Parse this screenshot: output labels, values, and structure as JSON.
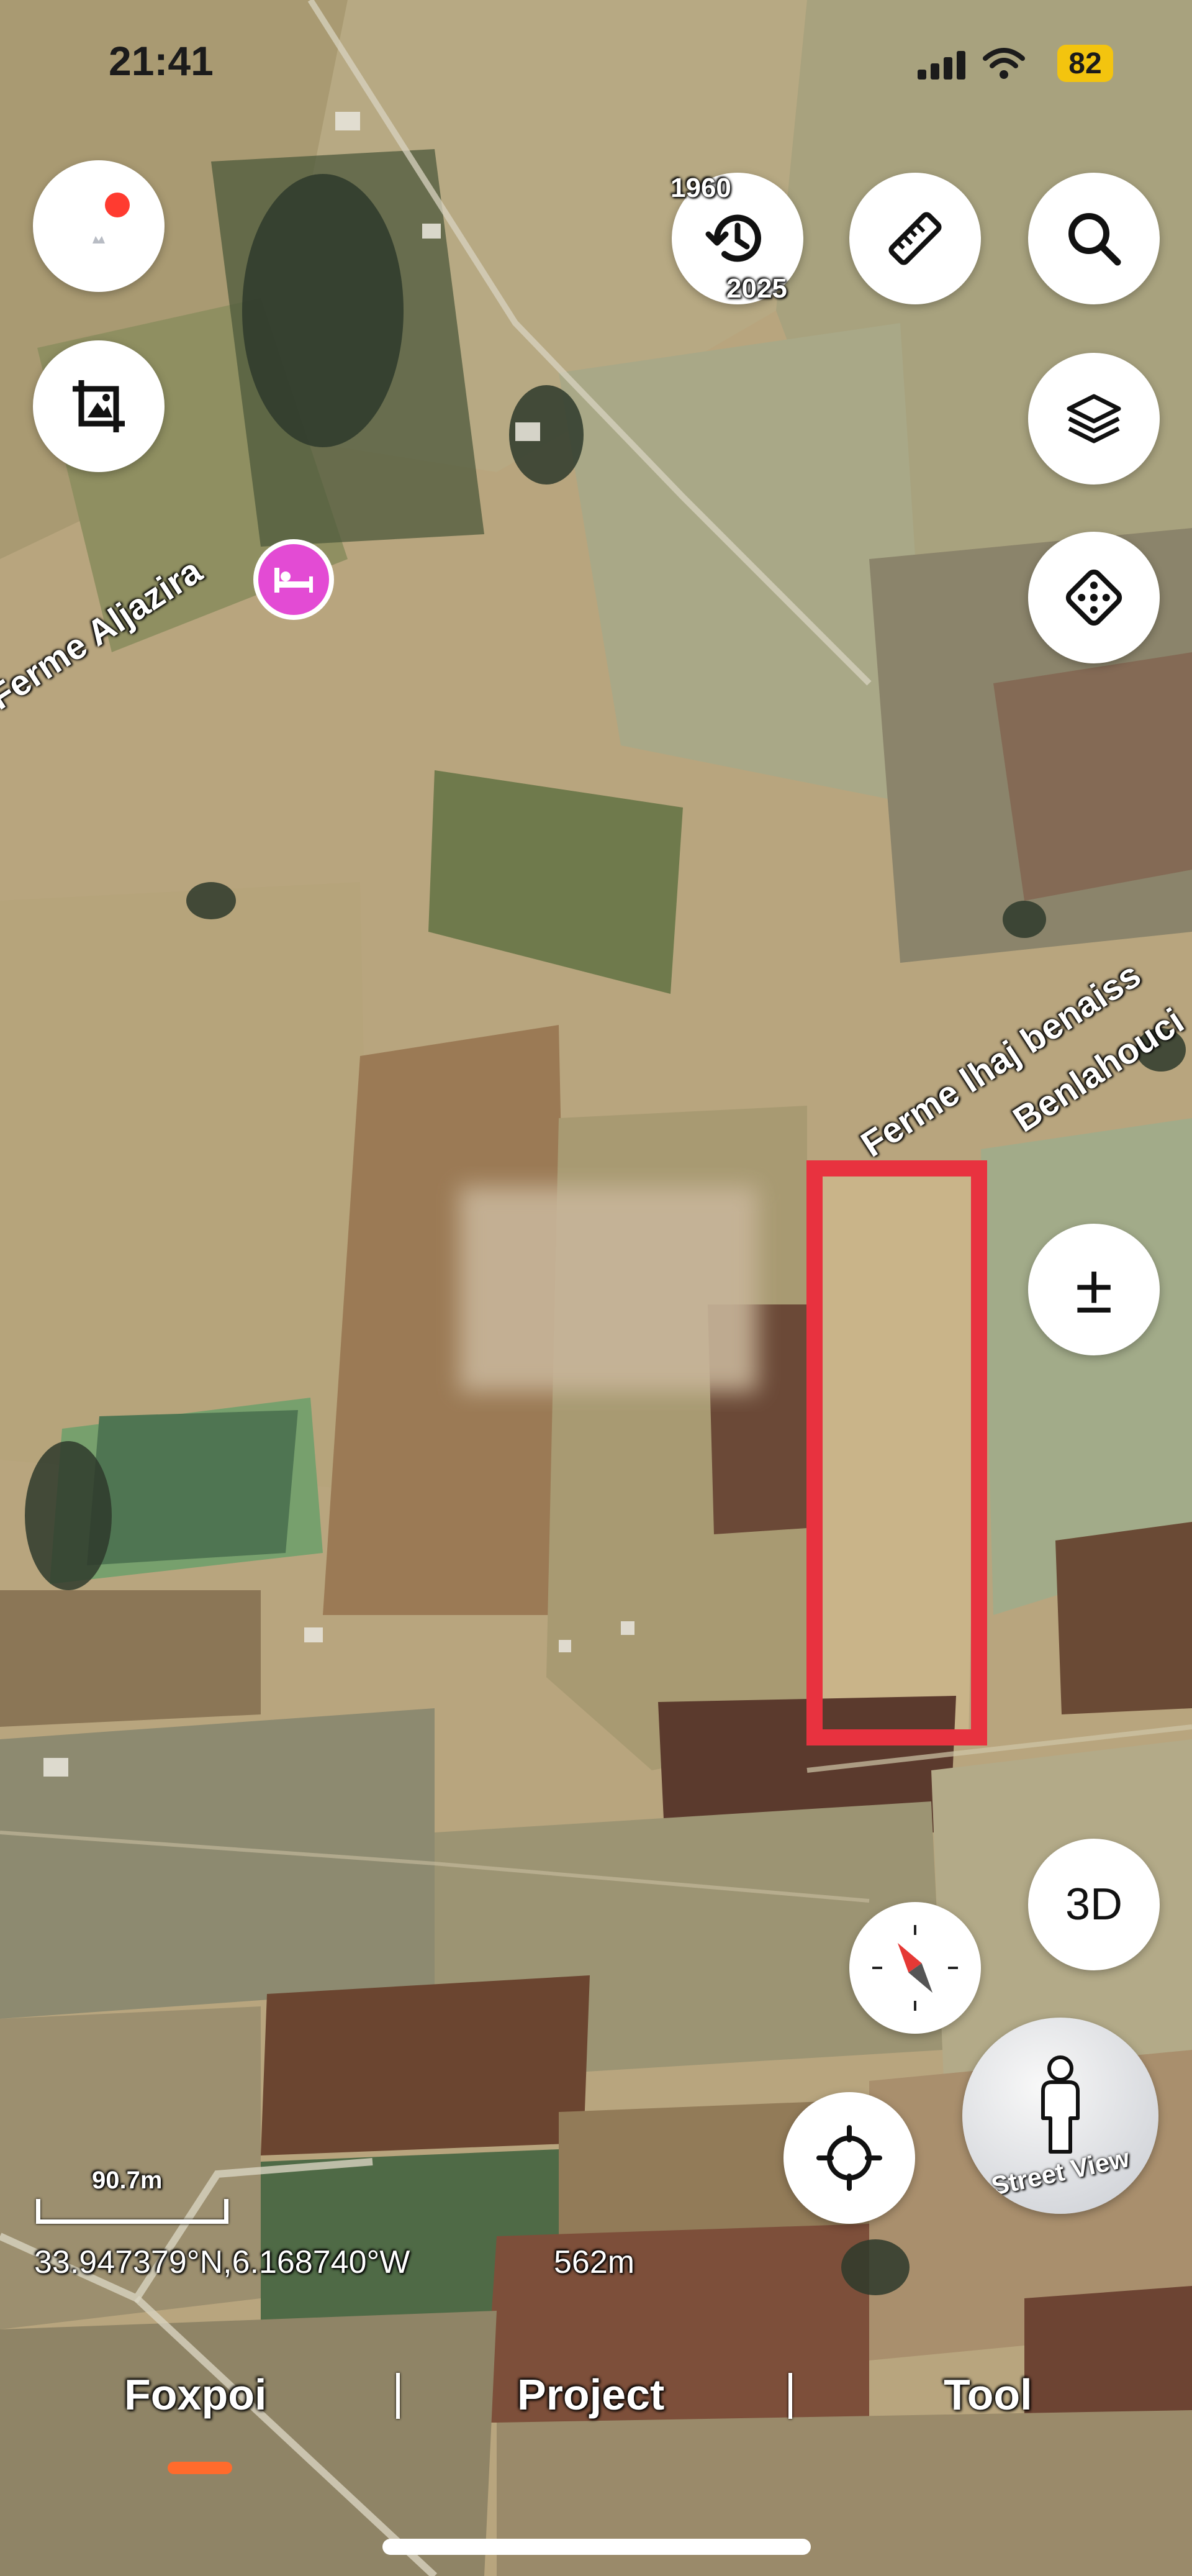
{
  "status_bar": {
    "time": "21:41",
    "battery": "82"
  },
  "timeline": {
    "year_start": "1960",
    "year_end": "2025"
  },
  "place_labels": [
    "Ferme Aljazira",
    "Ferme lhaj benaiss",
    "Benlahouci"
  ],
  "zoom_button_symbol": "±",
  "view_3d_label": "3D",
  "street_view_label": "Street View",
  "scale": {
    "distance": "90.7m"
  },
  "coordinates": "33.947379°N,6.168740°W",
  "altitude": "562m",
  "tabs": [
    "Foxpoi",
    "Project",
    "Tool"
  ],
  "active_tab": "Foxpoi",
  "colors": {
    "highlight_rect": "#e8323f",
    "tab_indicator": "#ff6b2c",
    "poi_pin": "#e34bd4"
  },
  "icons": [
    "profile-icon",
    "crop-image-icon",
    "history-clock-icon",
    "ruler-icon",
    "search-icon",
    "layers-icon",
    "dice-icon",
    "zoom-icon",
    "compass-icon",
    "locate-icon",
    "street-view-person-icon",
    "hotel-bed-icon"
  ]
}
